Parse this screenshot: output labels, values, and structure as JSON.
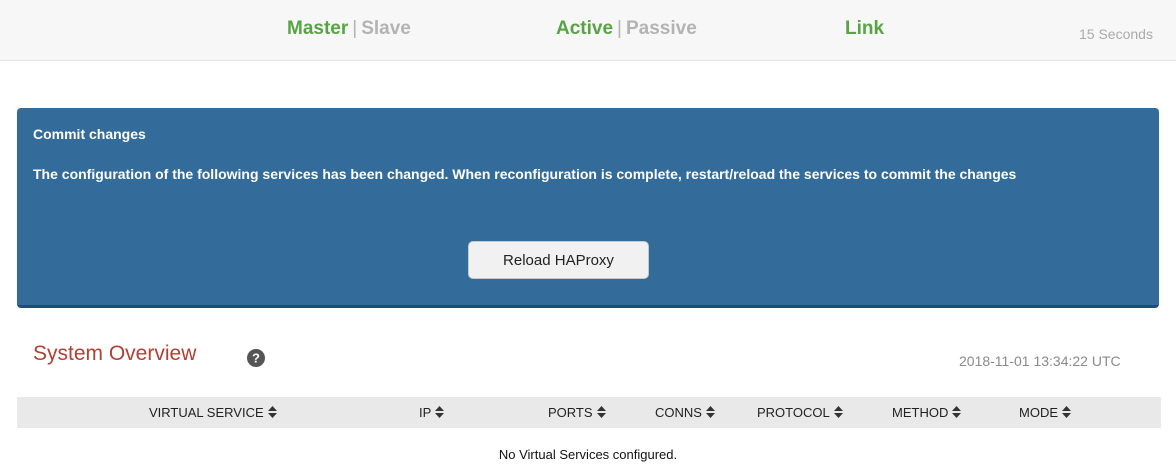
{
  "status_bar": {
    "master": "Master",
    "slave": "Slave",
    "active": "Active",
    "passive": "Passive",
    "link": "Link",
    "separator": "|",
    "refresh": "15 Seconds",
    "colors": {
      "on": "#58a444",
      "off": "#b3b3b3"
    }
  },
  "commit": {
    "title": "Commit changes",
    "message": "The configuration of the following services has been changed. When reconfiguration is complete, restart/reload the services to commit the changes",
    "reload_button": "Reload HAProxy",
    "panel_color": "#336b9b"
  },
  "overview": {
    "title": "System Overview",
    "help_icon": "question-circle-icon",
    "timestamp": "2018-11-01 13:34:22 UTC",
    "title_color": "#b34032"
  },
  "table": {
    "columns": [
      "VIRTUAL SERVICE",
      "IP",
      "PORTS",
      "CONNS",
      "PROTOCOL",
      "METHOD",
      "MODE"
    ],
    "sort_icon": "sort-icon",
    "empty_message": "No Virtual Services configured."
  }
}
